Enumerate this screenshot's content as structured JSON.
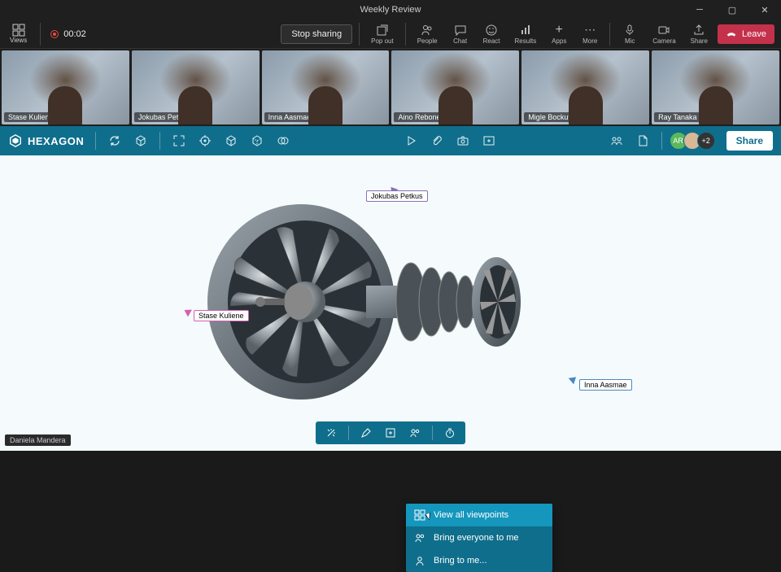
{
  "window": {
    "title": "Weekly Review"
  },
  "toolbar": {
    "views_label": "Views",
    "recording_time": "00:02",
    "stop_sharing": "Stop sharing",
    "buttons": [
      {
        "key": "popout",
        "label": "Pop out"
      },
      {
        "key": "people",
        "label": "People"
      },
      {
        "key": "chat",
        "label": "Chat"
      },
      {
        "key": "react",
        "label": "React"
      },
      {
        "key": "results",
        "label": "Results"
      },
      {
        "key": "apps",
        "label": "Apps"
      },
      {
        "key": "more",
        "label": "More"
      },
      {
        "key": "mic",
        "label": "Mic"
      },
      {
        "key": "camera",
        "label": "Camera"
      },
      {
        "key": "share",
        "label": "Share"
      }
    ],
    "leave": "Leave"
  },
  "participants": [
    {
      "name": "Stase Kuliene"
    },
    {
      "name": "Jokubas Petkus"
    },
    {
      "name": "Inna Aasmae"
    },
    {
      "name": "Aino Rebone"
    },
    {
      "name": "Migle Bockute"
    },
    {
      "name": "Ray Tanaka"
    }
  ],
  "hexbar": {
    "brand": "HEXAGON",
    "avatar_overflow": "+2",
    "share": "Share",
    "avatar1_initials": "AR"
  },
  "cursors": {
    "c1": "Jokubas Petkus",
    "c2": "Stase Kuliene",
    "c3": "Inna Aasmae"
  },
  "context_menu": {
    "items": [
      "View all viewpoints",
      "Bring everyone to me",
      "Bring to me..."
    ]
  },
  "bottom_left_name": "Daniela Mandera"
}
